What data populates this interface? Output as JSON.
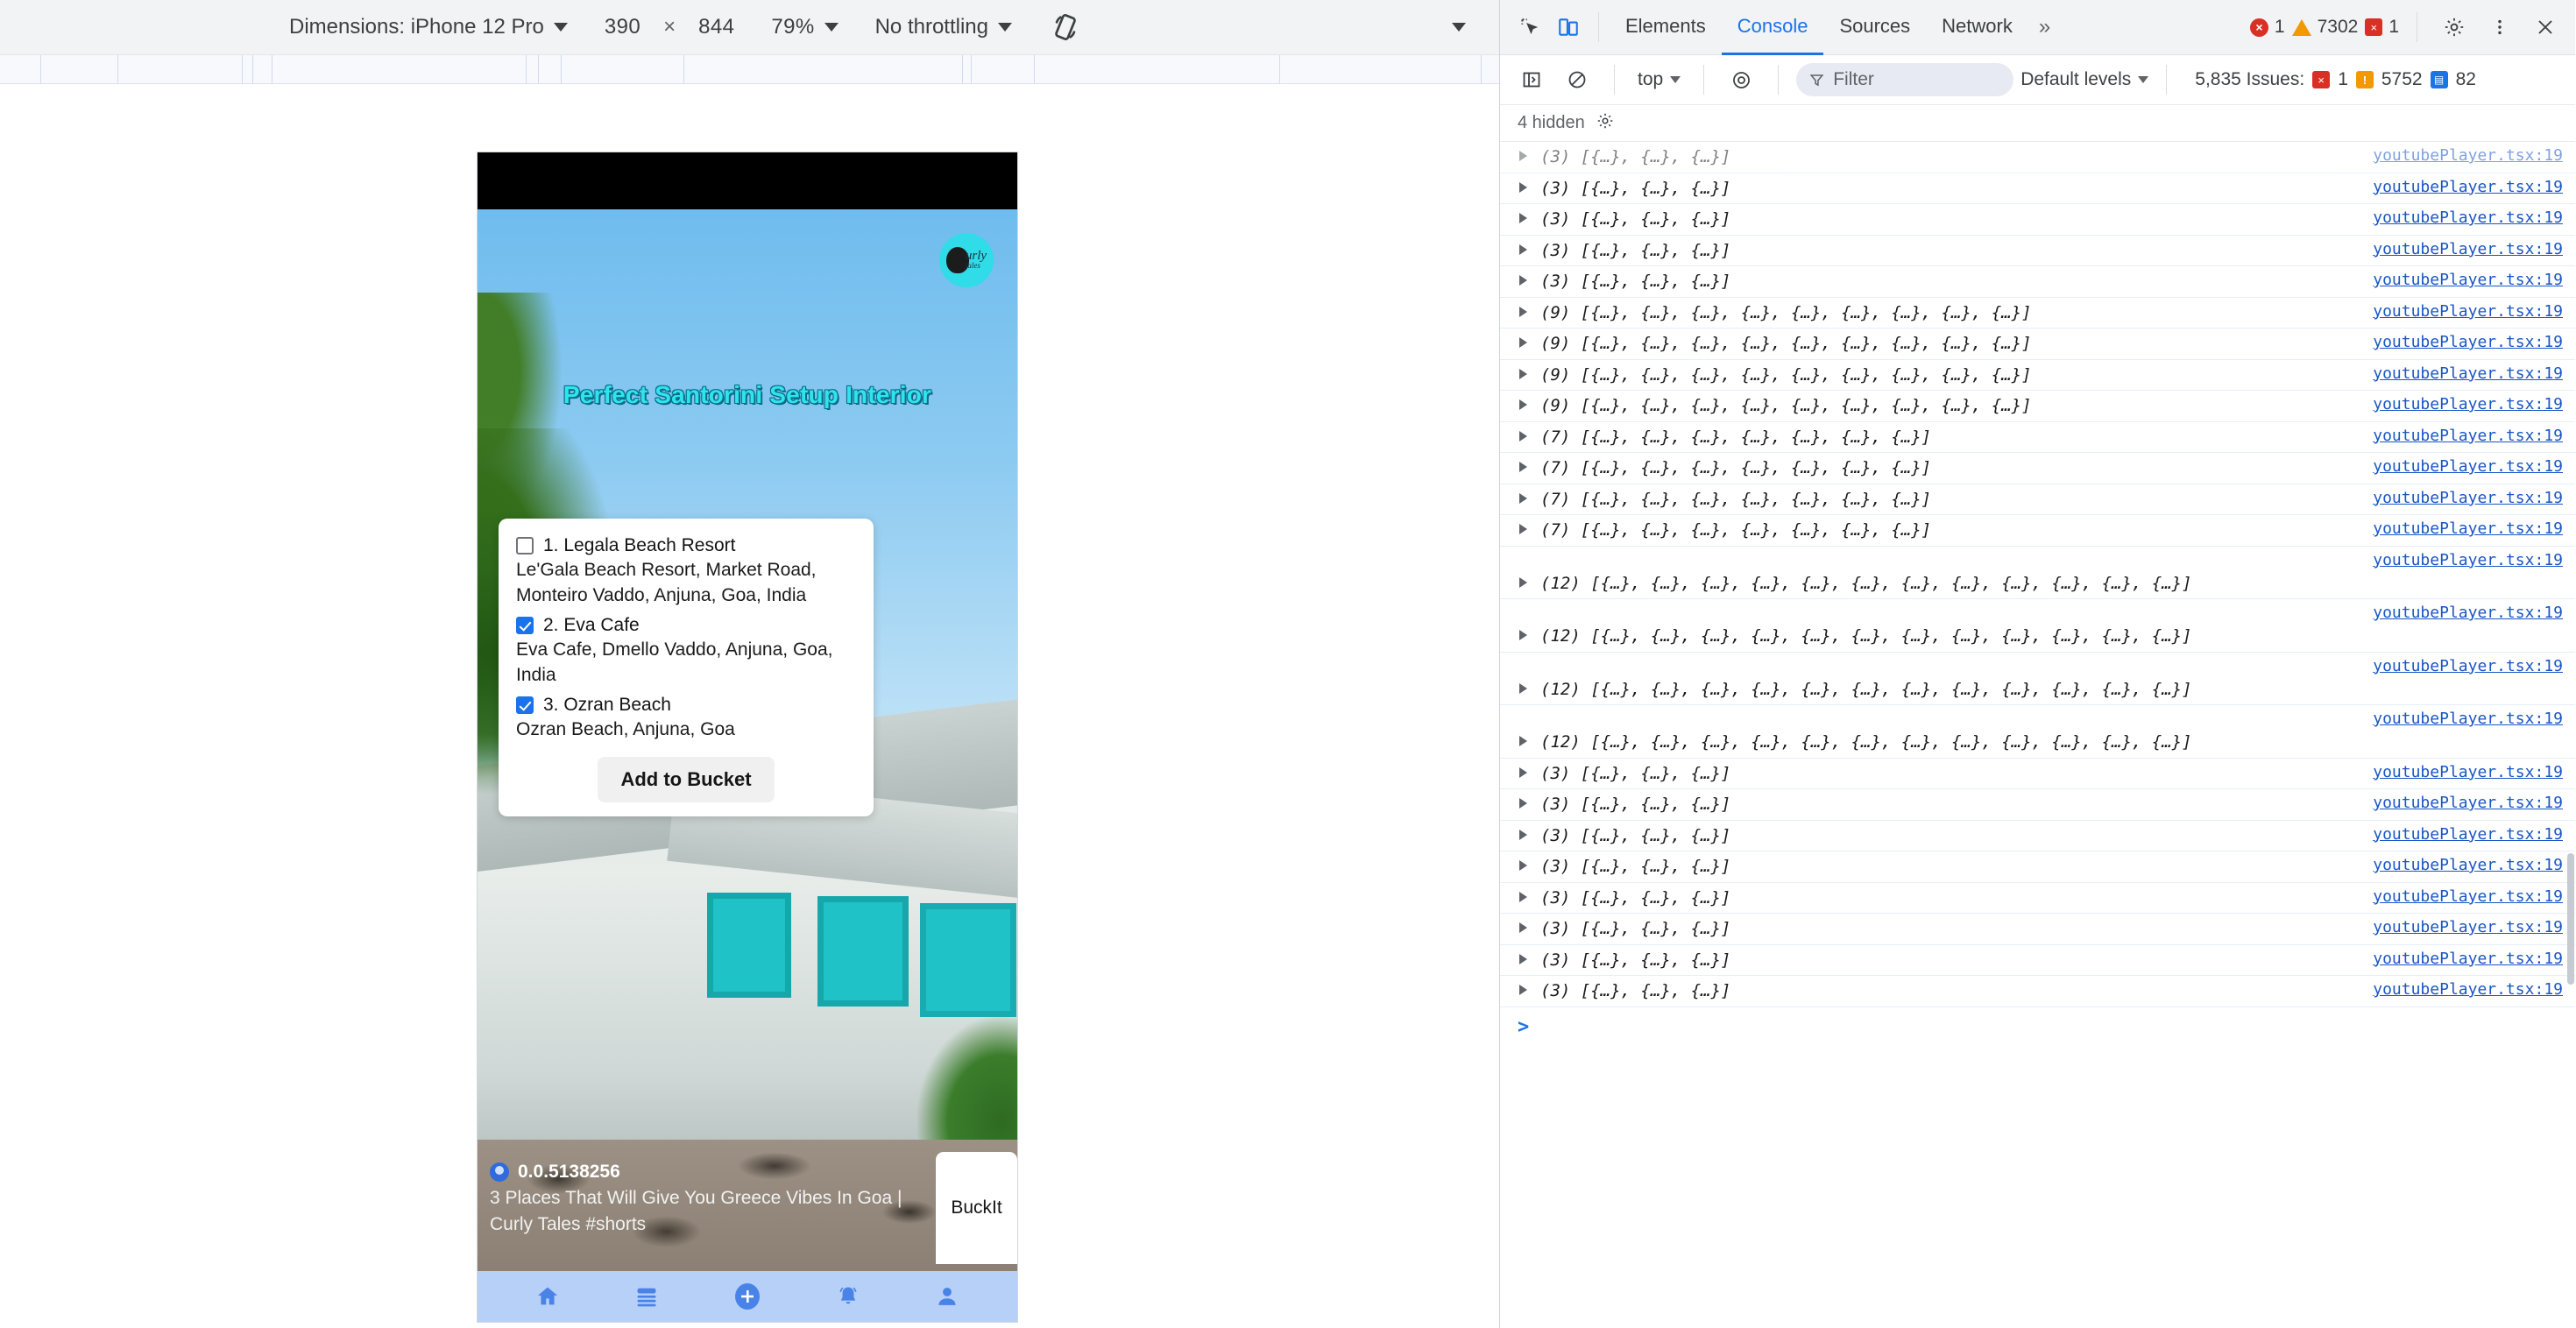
{
  "device_toolbar": {
    "dimensions_label": "Dimensions: iPhone 12 Pro",
    "width_value": "390",
    "times": "×",
    "height_value": "844",
    "zoom_value": "79%",
    "throttling_value": "No throttling",
    "rotate_icon": "rotate-icon",
    "more_caret_icon": "chevron-down-icon"
  },
  "phone": {
    "video": {
      "caption": "Perfect Santorini Setup Interior",
      "brand_name": "urly",
      "brand_sub": "tales"
    },
    "checklist": {
      "items": [
        {
          "title": "1. Legala Beach Resort",
          "address": "Le'Gala Beach Resort, Market Road, Monteiro Vaddo, Anjuna, Goa, India",
          "checked": false
        },
        {
          "title": "2. Eva Cafe",
          "address": "Eva Cafe, Dmello Vaddo, Anjuna, Goa, India",
          "checked": true
        },
        {
          "title": "3. Ozran Beach",
          "address": "Ozran Beach, Anjuna, Goa",
          "checked": true
        }
      ],
      "add_button": "Add to Bucket"
    },
    "video_info": {
      "username": "0.0.5138256",
      "title": "3 Places That Will Give You Greece Vibes In Goa | Curly Tales #shorts",
      "buckit_label": "BuckIt"
    },
    "bottom_nav": [
      {
        "name": "home-icon"
      },
      {
        "name": "list-icon"
      },
      {
        "name": "add-icon"
      },
      {
        "name": "bell-icon"
      },
      {
        "name": "profile-icon"
      }
    ]
  },
  "devtools": {
    "tabs": [
      {
        "label": "Elements",
        "active": false
      },
      {
        "label": "Console",
        "active": true
      },
      {
        "label": "Sources",
        "active": false
      },
      {
        "label": "Network",
        "active": false
      }
    ],
    "more_tabs": "»",
    "counters": {
      "errors": "1",
      "warnings": "7302",
      "info": "1"
    },
    "filterbar": {
      "context": "top",
      "filter_placeholder": "Filter",
      "levels": "Default levels",
      "issues_label": "5,835 Issues:",
      "issue_errors": "1",
      "issue_warnings": "5752",
      "issue_infos": "82"
    },
    "hidden_bar": {
      "label": "4 hidden"
    },
    "console_rows": [
      {
        "count": "(3)",
        "text": "[{…}, {…}, {…}]",
        "src": "youtubePlayer.tsx:19",
        "wrap": false,
        "partial": true
      },
      {
        "count": "(3)",
        "text": "[{…}, {…}, {…}]",
        "src": "youtubePlayer.tsx:19",
        "wrap": false,
        "partial": false
      },
      {
        "count": "(3)",
        "text": "[{…}, {…}, {…}]",
        "src": "youtubePlayer.tsx:19",
        "wrap": false,
        "partial": false
      },
      {
        "count": "(3)",
        "text": "[{…}, {…}, {…}]",
        "src": "youtubePlayer.tsx:19",
        "wrap": false,
        "partial": false
      },
      {
        "count": "(3)",
        "text": "[{…}, {…}, {…}]",
        "src": "youtubePlayer.tsx:19",
        "wrap": false,
        "partial": false
      },
      {
        "count": "(9)",
        "text": "[{…}, {…}, {…}, {…}, {…}, {…}, {…}, {…}, {…}]",
        "src": "youtubePlayer.tsx:19",
        "wrap": false,
        "partial": false
      },
      {
        "count": "(9)",
        "text": "[{…}, {…}, {…}, {…}, {…}, {…}, {…}, {…}, {…}]",
        "src": "youtubePlayer.tsx:19",
        "wrap": false,
        "partial": false
      },
      {
        "count": "(9)",
        "text": "[{…}, {…}, {…}, {…}, {…}, {…}, {…}, {…}, {…}]",
        "src": "youtubePlayer.tsx:19",
        "wrap": false,
        "partial": false
      },
      {
        "count": "(9)",
        "text": "[{…}, {…}, {…}, {…}, {…}, {…}, {…}, {…}, {…}]",
        "src": "youtubePlayer.tsx:19",
        "wrap": false,
        "partial": false
      },
      {
        "count": "(7)",
        "text": "[{…}, {…}, {…}, {…}, {…}, {…}, {…}]",
        "src": "youtubePlayer.tsx:19",
        "wrap": false,
        "partial": false
      },
      {
        "count": "(7)",
        "text": "[{…}, {…}, {…}, {…}, {…}, {…}, {…}]",
        "src": "youtubePlayer.tsx:19",
        "wrap": false,
        "partial": false
      },
      {
        "count": "(7)",
        "text": "[{…}, {…}, {…}, {…}, {…}, {…}, {…}]",
        "src": "youtubePlayer.tsx:19",
        "wrap": false,
        "partial": false
      },
      {
        "count": "(7)",
        "text": "[{…}, {…}, {…}, {…}, {…}, {…}, {…}]",
        "src": "youtubePlayer.tsx:19",
        "wrap": false,
        "partial": false
      },
      {
        "count": "(12)",
        "text": "[{…}, {…}, {…}, {…}, {…}, {…}, {…}, {…}, {…}, {…}, {…}, {…}]",
        "src": "youtubePlayer.tsx:19",
        "wrap": true,
        "partial": false
      },
      {
        "count": "(12)",
        "text": "[{…}, {…}, {…}, {…}, {…}, {…}, {…}, {…}, {…}, {…}, {…}, {…}]",
        "src": "youtubePlayer.tsx:19",
        "wrap": true,
        "partial": false
      },
      {
        "count": "(12)",
        "text": "[{…}, {…}, {…}, {…}, {…}, {…}, {…}, {…}, {…}, {…}, {…}, {…}]",
        "src": "youtubePlayer.tsx:19",
        "wrap": true,
        "partial": false
      },
      {
        "count": "(12)",
        "text": "[{…}, {…}, {…}, {…}, {…}, {…}, {…}, {…}, {…}, {…}, {…}, {…}]",
        "src": "youtubePlayer.tsx:19",
        "wrap": true,
        "partial": false
      },
      {
        "count": "(3)",
        "text": "[{…}, {…}, {…}]",
        "src": "youtubePlayer.tsx:19",
        "wrap": false,
        "partial": false
      },
      {
        "count": "(3)",
        "text": "[{…}, {…}, {…}]",
        "src": "youtubePlayer.tsx:19",
        "wrap": false,
        "partial": false
      },
      {
        "count": "(3)",
        "text": "[{…}, {…}, {…}]",
        "src": "youtubePlayer.tsx:19",
        "wrap": false,
        "partial": false
      },
      {
        "count": "(3)",
        "text": "[{…}, {…}, {…}]",
        "src": "youtubePlayer.tsx:19",
        "wrap": false,
        "partial": false
      },
      {
        "count": "(3)",
        "text": "[{…}, {…}, {…}]",
        "src": "youtubePlayer.tsx:19",
        "wrap": false,
        "partial": false
      },
      {
        "count": "(3)",
        "text": "[{…}, {…}, {…}]",
        "src": "youtubePlayer.tsx:19",
        "wrap": false,
        "partial": false
      },
      {
        "count": "(3)",
        "text": "[{…}, {…}, {…}]",
        "src": "youtubePlayer.tsx:19",
        "wrap": false,
        "partial": false
      },
      {
        "count": "(3)",
        "text": "[{…}, {…}, {…}]",
        "src": "youtubePlayer.tsx:19",
        "wrap": false,
        "partial": false
      }
    ],
    "prompt": ">"
  },
  "colors": {
    "accent_blue": "#1a73e8",
    "error_red": "#d93025",
    "warn_orange": "#f29900",
    "nav_bg": "#b6d0f8",
    "caption_cyan": "#2fe4ef"
  }
}
